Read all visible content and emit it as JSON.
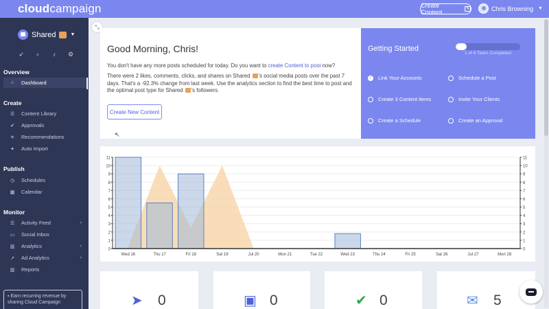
{
  "app": {
    "logo_bold": "cloud",
    "logo_rest": "campaign"
  },
  "header": {
    "create_label": "Create Content",
    "user_name": "Chris Browning"
  },
  "sidebar": {
    "account": "Shared",
    "sections": [
      {
        "title": "Overview",
        "items": [
          {
            "label": "Dashboard",
            "icon": "home-icon"
          }
        ]
      },
      {
        "title": "Create",
        "items": [
          {
            "label": "Content Library",
            "icon": "list-icon"
          },
          {
            "label": "Approvals",
            "icon": "check-circle-icon"
          },
          {
            "label": "Recommendations",
            "icon": "lightbulb-icon"
          },
          {
            "label": "Auto Import",
            "icon": "magic-icon"
          }
        ]
      },
      {
        "title": "Publish",
        "items": [
          {
            "label": "Schedules",
            "icon": "clock-icon"
          },
          {
            "label": "Calendar",
            "icon": "calendar-icon"
          }
        ]
      },
      {
        "title": "Monitor",
        "items": [
          {
            "label": "Activity Feed",
            "icon": "list-icon"
          },
          {
            "label": "Social Inbox",
            "icon": "inbox-icon"
          },
          {
            "label": "Analytics",
            "icon": "bar-chart-icon"
          },
          {
            "label": "Ad Analytics",
            "icon": "line-chart-icon"
          },
          {
            "label": "Reports",
            "icon": "bar-chart-icon"
          }
        ]
      }
    ],
    "earn_text": "Earn recurring revenue by sharing Cloud Campaign"
  },
  "greeting": {
    "title": "Good Morning, Chris!",
    "p1_before": "You don't have any more posts scheduled for today. Do you want to ",
    "p1_link": "create Content to post",
    "p1_after": " now?",
    "p2_a": "There were 2 likes, comments, clicks, and shares on Shared ",
    "p2_b": "'s social media posts over the past 7 days. That's a -92.3% change from last week. Use the analytics section to find the best time to post and the optimal post type for Shared ",
    "p2_c": "'s followers.",
    "button": "Create New Content"
  },
  "getting_started": {
    "title": "Getting Started",
    "progress_label": "1 of 6 Tasks Completed",
    "progress_fraction": 0.1667,
    "tasks": [
      {
        "label": "Link Your Accounts",
        "done": true
      },
      {
        "label": "Schedule a Post",
        "done": false
      },
      {
        "label": "Create 3 Content items",
        "done": false
      },
      {
        "label": "Invite Your Clients",
        "done": false
      },
      {
        "label": "Create a Schedule",
        "done": false
      },
      {
        "label": "Create an Approval",
        "done": false
      }
    ]
  },
  "chart_data": {
    "type": "bar",
    "categories": [
      "Wed 16",
      "Thu 17",
      "Fri 18",
      "Sat 19",
      "Jul 20",
      "Mon 21",
      "Tue 22",
      "Wed 23",
      "Thu 24",
      "Fri 25",
      "Sat 26",
      "Jul 27",
      "Mon 28"
    ],
    "ylim": [
      0,
      11
    ],
    "yticks": [
      "0",
      "1",
      "2",
      "3",
      "4",
      "5",
      "6",
      "7",
      "8",
      "9",
      "10",
      "11"
    ],
    "series": [
      {
        "type": "bar",
        "values": [
          11,
          5.5,
          9,
          0,
          0,
          0,
          0,
          1.8,
          0,
          0,
          0,
          0,
          0
        ],
        "color": "#9fb8d8"
      },
      {
        "type": "area",
        "values": [
          0.2,
          10,
          2.5,
          10,
          0,
          0,
          0,
          0,
          0,
          0,
          0,
          0,
          0
        ],
        "color": "#f8d4a8"
      }
    ],
    "grid": true,
    "dual_axis": true
  },
  "stats": [
    {
      "icon": "paper-plane-icon",
      "value": "0",
      "color": "#4f62d6"
    },
    {
      "icon": "calendar-check-icon",
      "value": "0",
      "color": "#4f62d6"
    },
    {
      "icon": "check-circle-icon",
      "value": "0",
      "color": "#2ea84a"
    },
    {
      "icon": "comments-icon",
      "value": "5",
      "color": "#5b8fe0"
    }
  ]
}
